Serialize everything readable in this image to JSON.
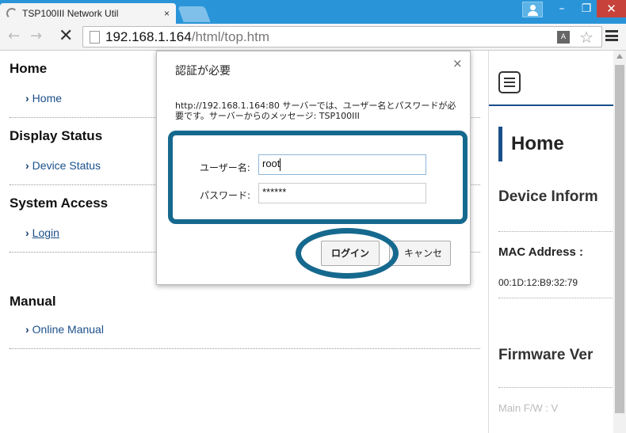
{
  "browser": {
    "tab_title": "TSP100III Network Util",
    "tab_close": "×",
    "win_min": "–",
    "win_max": "❐",
    "win_close": "✕",
    "url_host": "192.168.1.164",
    "url_path": "/html/top.htm",
    "nav_back": "←",
    "nav_forward": "→",
    "stop": "✕"
  },
  "leftnav": {
    "sections": [
      {
        "heading": "Home",
        "link": "Home"
      },
      {
        "heading": "Display Status",
        "link": "Device Status"
      },
      {
        "heading": "System Access",
        "link": "Login"
      },
      {
        "heading": "Manual",
        "link": "Online Manual"
      }
    ]
  },
  "rightpanel": {
    "title": "Home",
    "device_info_heading": "Device Inform",
    "mac_label": "MAC Address :",
    "mac_value": "00:1D:12:B9:32:79",
    "firmware_heading": "Firmware Ver",
    "main_fw_label": "Main F/W : V"
  },
  "dialog": {
    "title": "認証が必要",
    "close": "×",
    "message": "http://192.168.1.164:80 サーバーでは、ユーザー名とパスワードが必要です。サーバーからのメッセージ: TSP100III",
    "username_label": "ユーザー名:",
    "username_value": "root",
    "password_label": "パスワード:",
    "password_value": "******",
    "login_button": "ログイン",
    "cancel_button": "キャンセル"
  },
  "colors": {
    "titlebar": "#2a94d8",
    "highlight": "#16698e",
    "link": "#1a4f8a"
  }
}
